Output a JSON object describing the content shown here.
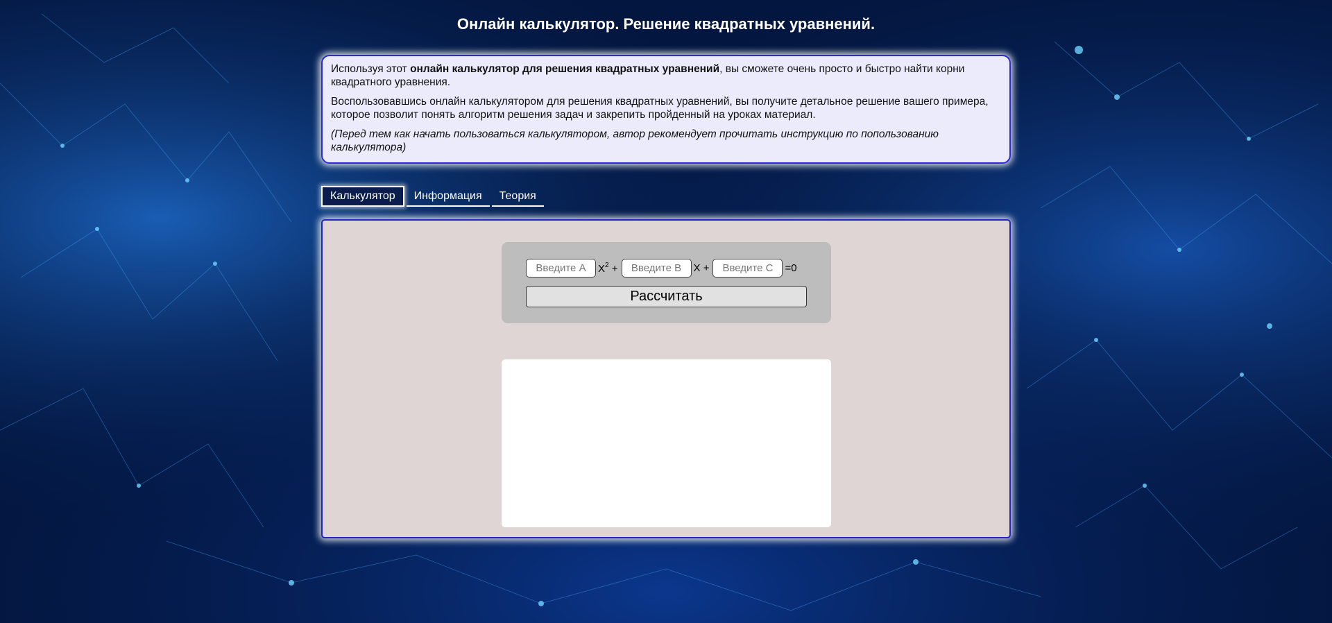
{
  "page": {
    "title": "Онлайн калькулятор. Решение квадратных уравнений."
  },
  "intro": {
    "p1_before": "Используя этот ",
    "p1_bold": "онлайн калькулятор для решения квадратных уравнений",
    "p1_after": ", вы сможете очень просто и быстро найти корни квадратного уравнения.",
    "p2": "Воспользовавшись онлайн калькулятором для решения квадратных уравнений, вы получите детальное решение вашего примера, которое позволит понять алгоритм решения задач и закрепить пройденный на уроках материал.",
    "p3": "(Перед тем как начать пользоваться калькулятором, автор рекомендует прочитать инструкцию по попользованию калькулятора)"
  },
  "tabs": [
    {
      "label": "Калькулятор",
      "active": true
    },
    {
      "label": "Информация",
      "active": false
    },
    {
      "label": "Теория",
      "active": false
    }
  ],
  "calculator": {
    "input_a": {
      "placeholder": "Введите A",
      "value": ""
    },
    "term_a": "X",
    "term_a_power": "2",
    "term_a_suffix": " +",
    "input_b": {
      "placeholder": "Введите B",
      "value": ""
    },
    "term_b": "X +",
    "input_c": {
      "placeholder": "Введите C",
      "value": ""
    },
    "equals": "=0",
    "button_label": "Рассчитать"
  },
  "colors": {
    "background": "#041a4a",
    "panel_border": "#2323c9",
    "intro_background": "#ecebfb",
    "calc_panel_background": "#dfd5d5",
    "input_card_background": "#bdbdbd"
  }
}
